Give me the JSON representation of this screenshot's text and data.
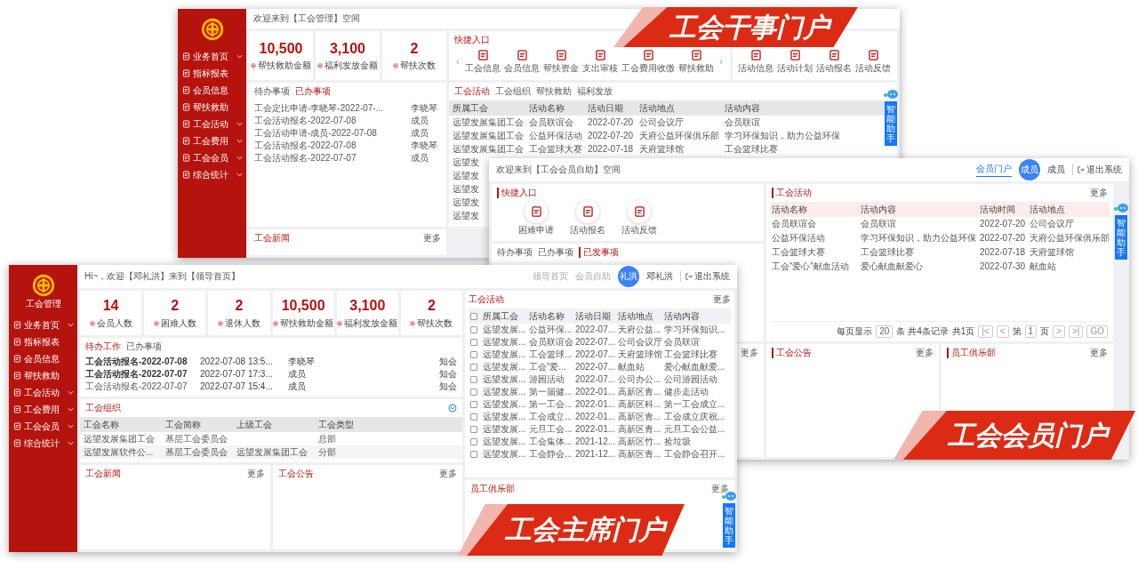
{
  "admin_portal": {
    "sidebar": {
      "items": [
        {
          "label": "业务首页",
          "has_submenu": true
        },
        {
          "label": "指标报表",
          "has_submenu": false
        },
        {
          "label": "会员信息",
          "has_submenu": false
        },
        {
          "label": "帮扶救助",
          "has_submenu": false
        },
        {
          "label": "工会活动",
          "has_submenu": true
        },
        {
          "label": "工会费用",
          "has_submenu": true
        },
        {
          "label": "工会会员",
          "has_submenu": true
        },
        {
          "label": "综合统计",
          "has_submenu": true
        }
      ]
    },
    "welcome": "欢迎来到【工会管理】空间",
    "stats": [
      {
        "value": "10,500",
        "label": "帮扶救助金额"
      },
      {
        "value": "3,100",
        "label": "福利发放金额"
      },
      {
        "value": "2",
        "label": "帮扶次数"
      }
    ],
    "quick_entry": {
      "title": "快捷入口",
      "prev": "‹",
      "next": "›",
      "items": [
        "工会信息",
        "会员信息",
        "帮扶资金",
        "支出审核",
        "工会费用收缴",
        "帮扶救助"
      ],
      "more_items": [
        "活动信息",
        "活动计划",
        "活动报名",
        "活动反馈"
      ]
    },
    "todo": {
      "tabs": [
        {
          "label": "待办事项",
          "selected": false
        },
        {
          "label": "已办事项",
          "selected": true
        }
      ],
      "rows": [
        {
          "title": "工会定比申请-李晓琴-2022-07-...",
          "person": "李晓琴"
        },
        {
          "title": "工会活动报名-2022-07-08",
          "person": "成员"
        },
        {
          "title": "工会活动申请-成员-2022-07-08",
          "person": "成员"
        },
        {
          "title": "工会活动报名-2022-07-08",
          "person": "李晓琴"
        },
        {
          "title": "工会活动报名-2022-07-07",
          "person": "成员"
        }
      ]
    },
    "activity": {
      "tabs": [
        {
          "label": "工会活动",
          "selected": true
        },
        {
          "label": "工会组织",
          "selected": false
        },
        {
          "label": "帮扶救助",
          "selected": false
        },
        {
          "label": "福利发放",
          "selected": false
        }
      ],
      "columns": [
        "所属工会",
        "活动名称",
        "活动日期",
        "活动地点",
        "活动内容"
      ],
      "rows": [
        [
          "远望发展集团工会",
          "会员联谊会",
          "2022-07-20",
          "公司会议厅",
          "会员联谊"
        ],
        [
          "远望发展集团工会",
          "公益环保活动",
          "2022-07-20",
          "天府公益环保俱乐部",
          "学习环保知识，助力公益环保"
        ],
        [
          "远望发展集团工会",
          "工会篮球大赛",
          "2022-07-18",
          "天府篮球馆",
          "工会篮球比赛"
        ],
        [
          "远望发"
        ],
        [
          "远望发"
        ],
        [
          "远望发"
        ],
        [
          "远望发"
        ],
        [
          "远望发"
        ]
      ]
    },
    "news": {
      "title": "工会新闻",
      "more": "更多"
    },
    "assistant": "智能助手"
  },
  "member_portal": {
    "welcome": "欢迎来到【工会会员自助】空间",
    "nav": [
      {
        "label": "会员门户",
        "selected": true
      }
    ],
    "user": {
      "avatar": "成员",
      "name": "成员",
      "logout": "退出系统"
    },
    "quick_entry": {
      "title": "快捷入口",
      "items": [
        "困难申请",
        "活动报名",
        "活动反馈"
      ]
    },
    "tasks": {
      "tabs": [
        {
          "label": "待办事项",
          "selected": false
        },
        {
          "label": "已办事项",
          "selected": false
        },
        {
          "label": "已发事项",
          "selected": true
        }
      ]
    },
    "activity": {
      "title": "工会活动",
      "more": "更多",
      "columns": [
        "活动名称",
        "活动内容",
        "活动时间",
        "活动地点"
      ],
      "rows": [
        [
          "会员联谊会",
          "会员联谊",
          "2022-07-20",
          "公司会议厅"
        ],
        [
          "公益环保活动",
          "学习环保知识，助力公益环保",
          "2022-07-20",
          "天府公益环保俱乐部"
        ],
        [
          "工会篮球大赛",
          "工会篮球比赛",
          "2022-07-18",
          "天府篮球馆"
        ],
        [
          "工会“爱心”献血活动",
          "爱心献血献爱心",
          "2022-07-30",
          "献血站"
        ]
      ],
      "pagination": {
        "per_page_label": "每页显示",
        "per_page": "20",
        "total": "条 共4条记录",
        "pages": "共1页",
        "first": "|<",
        "prev": "<",
        "page_label": "第",
        "page": "1",
        "page_suffix": "页",
        "next": ">",
        "last": ">|",
        "go": "GO"
      }
    },
    "left_more": "更多",
    "notice": {
      "title": "工会公告",
      "more": "更多"
    },
    "club": {
      "title": "员工俱乐部",
      "more": "更多"
    },
    "assistant": "智能助手"
  },
  "chairman_portal": {
    "sidebar": {
      "logo_label": "工会管理",
      "items": [
        {
          "label": "业务首页",
          "has_submenu": true
        },
        {
          "label": "指标报表",
          "has_submenu": false
        },
        {
          "label": "会员信息",
          "has_submenu": false
        },
        {
          "label": "帮扶救助",
          "has_submenu": false
        },
        {
          "label": "工会活动",
          "has_submenu": true
        },
        {
          "label": "工会费用",
          "has_submenu": true
        },
        {
          "label": "工会会员",
          "has_submenu": true
        },
        {
          "label": "综合统计",
          "has_submenu": true
        }
      ]
    },
    "welcome": "Hi~，欢迎【邓礼洪】来到【领导首页】",
    "nav": [
      {
        "label": "领导首页",
        "selected": false
      },
      {
        "label": "会员自助",
        "selected": false
      }
    ],
    "user": {
      "avatar": "礼洪",
      "name": "邓礼洪",
      "logout": "退出系统"
    },
    "stats": [
      {
        "value": "14",
        "label": "会员人数"
      },
      {
        "value": "2",
        "label": "困难人数"
      },
      {
        "value": "2",
        "label": "退休人数"
      },
      {
        "value": "10,500",
        "label": "帮扶救助金额"
      },
      {
        "value": "3,100",
        "label": "福利发放金额"
      },
      {
        "value": "2",
        "label": "帮扶次数"
      }
    ],
    "todo": {
      "tabs": [
        {
          "label": "待办工作",
          "selected": true
        },
        {
          "label": "已办事项",
          "selected": false
        }
      ],
      "rows": [
        {
          "title": "工会活动报名-2022-07-08",
          "time": "2022-07-08 13:5...",
          "person": "李晓琴",
          "type": "知会",
          "unread": true
        },
        {
          "title": "工会活动报名-2022-07-07",
          "time": "2022-07-07 17:3...",
          "person": "成员",
          "type": "知会",
          "unread": true
        },
        {
          "title": "工会活动报名-2022-07-07",
          "time": "2022-07-07 15:4...",
          "person": "成员",
          "type": "知会",
          "unread": false
        }
      ]
    },
    "organization": {
      "title": "工会组织",
      "columns": [
        "工会名称",
        "工会简称",
        "上级工会",
        "工会类型"
      ],
      "rows": [
        {
          "name": "远望发展集团工会",
          "short": "基层工会委员会",
          "type": "总部"
        },
        {
          "name": "远望发展软件公...",
          "short": "基层工会委员会",
          "parent": "远望发展集团工会",
          "type": "分部"
        }
      ]
    },
    "activity": {
      "title": "工会活动",
      "more": "更多",
      "all_checked": false,
      "columns": [
        "所属工会",
        "活动名称",
        "活动日期",
        "活动地点",
        "活动内容"
      ],
      "rows": [
        {
          "checked": false,
          "cells": [
            "远望发展...",
            "公益环保...",
            "2022-07...",
            "天府公益...",
            "学习环保知识..."
          ]
        },
        {
          "checked": false,
          "cells": [
            "远望发展...",
            "会员联谊会",
            "2022-07...",
            "公司会议厅",
            "会员联谊"
          ]
        },
        {
          "checked": false,
          "cells": [
            "远望发展...",
            "工会篮球...",
            "2022-07...",
            "天府篮球馆",
            "工会篮球比赛"
          ]
        },
        {
          "checked": false,
          "cells": [
            "远望发展...",
            "工会“爱...",
            "2022-07...",
            "献血站",
            "爱心献血献爱..."
          ]
        },
        {
          "checked": false,
          "cells": [
            "远望发展...",
            "游园活动",
            "2022-07...",
            "公司办公...",
            "公司游园活动"
          ]
        },
        {
          "checked": false,
          "cells": [
            "远望发展...",
            "第一届健...",
            "2022-01...",
            "高新区青...",
            "健步走活动"
          ]
        },
        {
          "checked": false,
          "cells": [
            "远望发展...",
            "第一工会...",
            "2022-01...",
            "高新区科...",
            "第一工会成立..."
          ]
        },
        {
          "checked": false,
          "cells": [
            "远望发展...",
            "工会成立...",
            "2022-01...",
            "高新区青...",
            "工会成立庆祝..."
          ]
        },
        {
          "checked": false,
          "cells": [
            "远望发展...",
            "元旦工会...",
            "2022-01...",
            "高新区青...",
            "元旦工会公益..."
          ]
        },
        {
          "checked": false,
          "cells": [
            "远望发展...",
            "工会集体...",
            "2021-12...",
            "高新区竹...",
            "捡垃圾"
          ]
        },
        {
          "checked": false,
          "cells": [
            "远望发展...",
            "工会静会...",
            "2021-12...",
            "高新区青...",
            "工会静会召开..."
          ]
        }
      ]
    },
    "news": {
      "title": "工会新闻",
      "more": "更多"
    },
    "notice": {
      "title": "工会公告",
      "more": "更多"
    },
    "club": {
      "title": "员工俱乐部",
      "more": "更多"
    },
    "assistant": "智能助手"
  },
  "banners": [
    {
      "text": "工会干事门户"
    },
    {
      "text": "工会会员门户"
    },
    {
      "text": "工会主席门户"
    }
  ]
}
